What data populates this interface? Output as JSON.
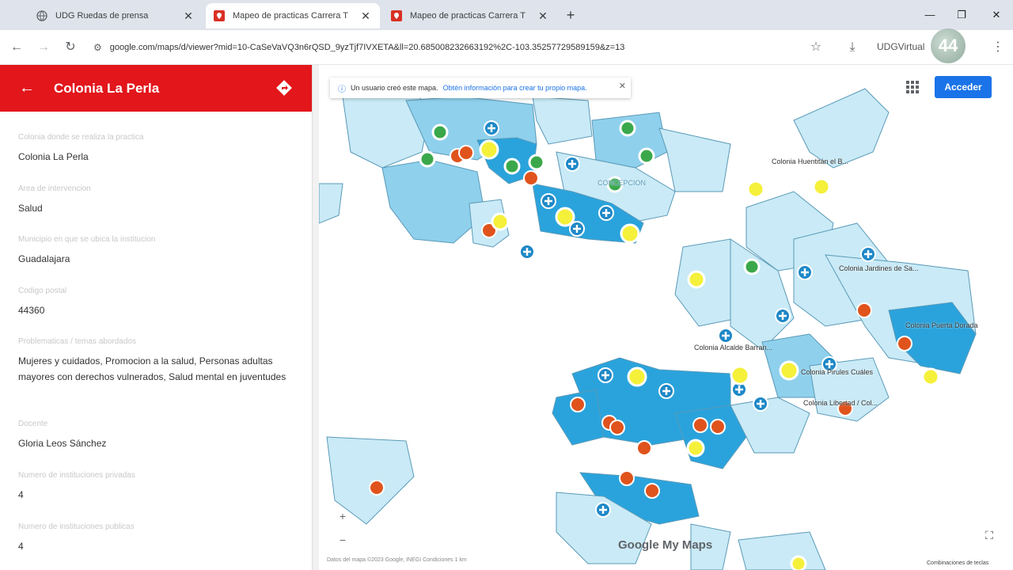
{
  "browser": {
    "tabs": [
      {
        "title": "UDG Ruedas de prensa",
        "active": false
      },
      {
        "title": "Mapeo de practicas Carrera T",
        "active": true
      },
      {
        "title": "Mapeo de practicas Carrera T",
        "active": false
      }
    ],
    "new_tab": "+",
    "url": "google.com/maps/d/viewer?mid=10-CaSeVaVQ3n6rQSD_9yzTjf7IVXETA&ll=20.685008232663192%2C-103.35257729589159&z=13",
    "profile": "UDGVirtual",
    "overlay_logo": "44"
  },
  "panel": {
    "title": "Colonia La Perla",
    "fields": [
      {
        "label": "Colonia donde se realiza la practica",
        "value": "Colonia La Perla"
      },
      {
        "label": "Area de intervencion",
        "value": "Salud"
      },
      {
        "label": "Municipio en que se ubica la institucion",
        "value": "Guadalajara"
      },
      {
        "label": "Codigo postal",
        "value": "44360"
      },
      {
        "label": "Problematicas / temas abordados",
        "value": "Mujeres y cuidados, Promocion a la salud, Personas adultas mayores con derechos vulnerados, Salud mental en juventudes"
      },
      {
        "label": "Docente",
        "value": "Gloria Leos Sánchez"
      },
      {
        "label": "Numero de instituciones privadas",
        "value": "4"
      },
      {
        "label": "Numero de instituciones publicas",
        "value": "4"
      }
    ]
  },
  "map": {
    "banner_text": "Un usuario creó este mapa.",
    "banner_link": "Obtén información para crear tu propio mapa.",
    "signin_label": "Acceder",
    "labels": [
      "Colonia Huentitán el B...",
      "Colonia Jardines de Sa...",
      "Colonia Alcalde Barran...",
      "Colonia Puerta Dorada",
      "Colonia Pirules Cuáles",
      "Colonia Libertad / Col...",
      "CONCEPCION"
    ],
    "zoom_in": "+",
    "zoom_out": "−",
    "google_logo": "Google My Maps",
    "attribution": "Datos del mapa ©2023 Google, INEGI   Condiciones   1 km",
    "shortcuts": "Combinaciones de teclas",
    "colors": {
      "light_region": "#c9eaf6",
      "mid_region": "#8fd0ec",
      "dark_region": "#2aa3dc",
      "region_stroke": "#5a9ab8",
      "marker_blue": "#1e88c7",
      "marker_green": "#3aa84a",
      "marker_orange": "#e0531d",
      "marker_yellow": "#f5f03a",
      "header_red": "#e2161b"
    }
  }
}
